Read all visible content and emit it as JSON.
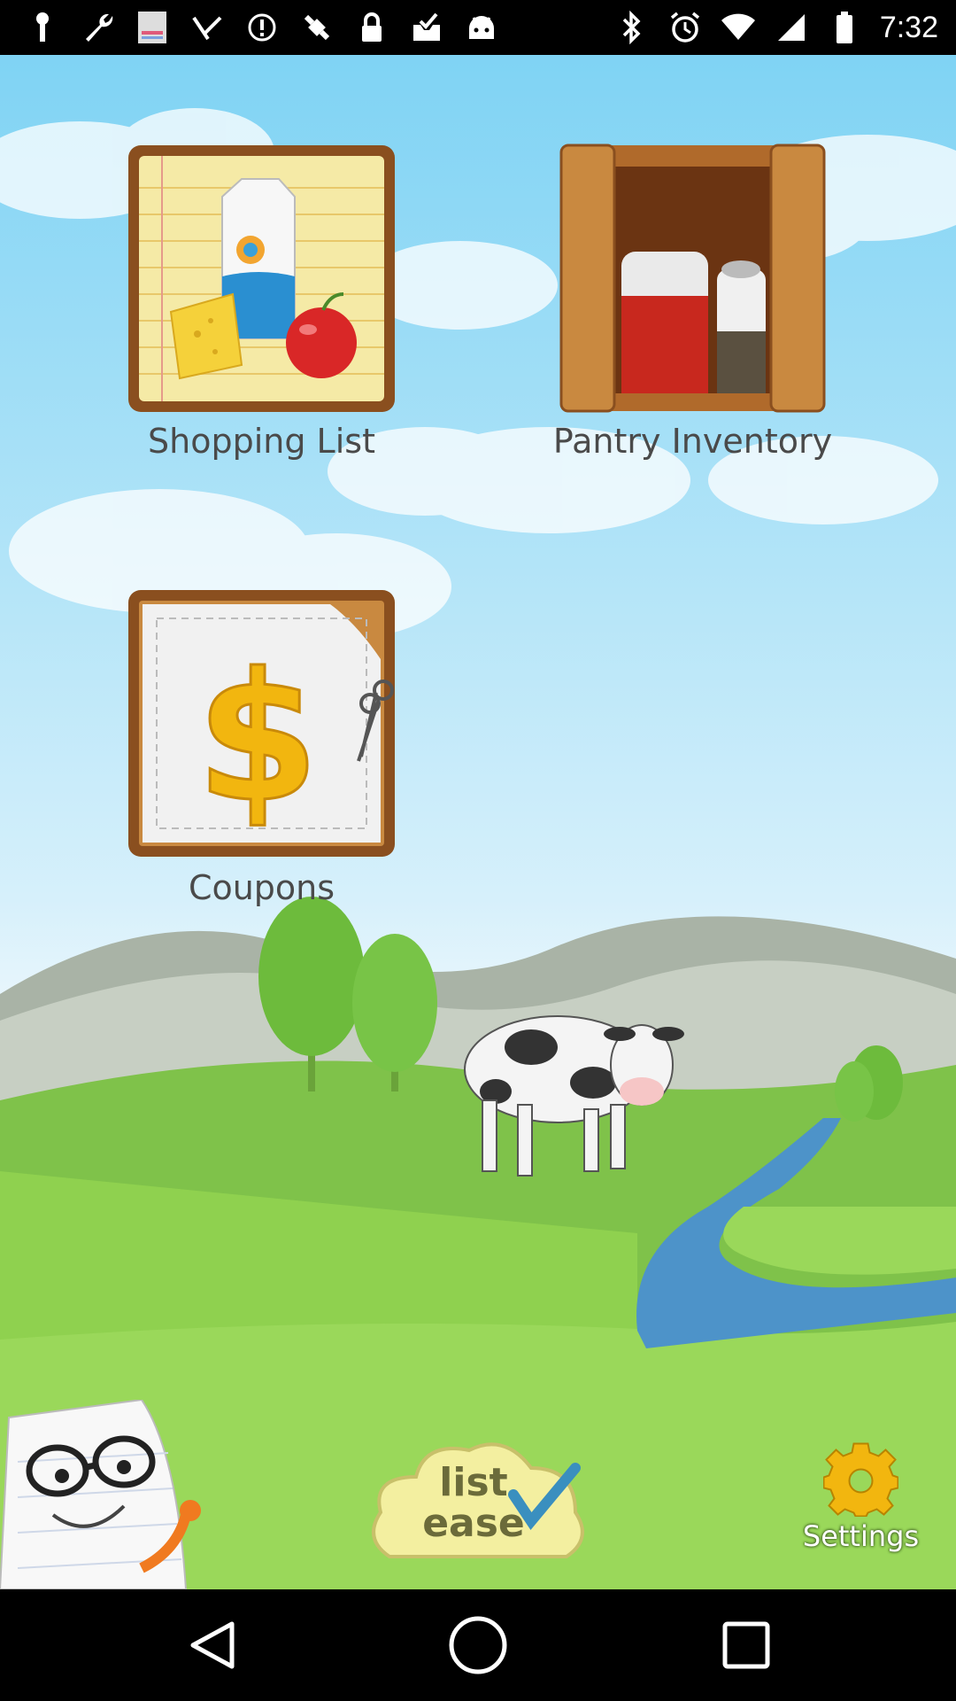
{
  "status_bar": {
    "time": "7:32",
    "left_icons": [
      "wrench-icon",
      "image-thumbnail-icon",
      "plant-icon",
      "info-circle-icon",
      "fake-gps-icon",
      "lock-icon",
      "inbox-icon",
      "android-icon"
    ],
    "right_icons": [
      "bluetooth-icon",
      "alarm-icon",
      "wifi-icon",
      "signal-icon",
      "battery-icon"
    ]
  },
  "tiles": {
    "shopping_list": {
      "label": "Shopping List"
    },
    "pantry_inventory": {
      "label": "Pantry Inventory"
    },
    "coupons": {
      "label": "Coupons"
    }
  },
  "bottom": {
    "logo_text_line1": "list",
    "logo_text_line2": "ease",
    "settings_label": "Settings"
  },
  "colors": {
    "sky_top": "#7fd3f4",
    "grass": "#8fd14f",
    "wood": "#b06a2b",
    "label_gray": "#4a4a4a",
    "gear_yellow": "#f2b60f"
  }
}
